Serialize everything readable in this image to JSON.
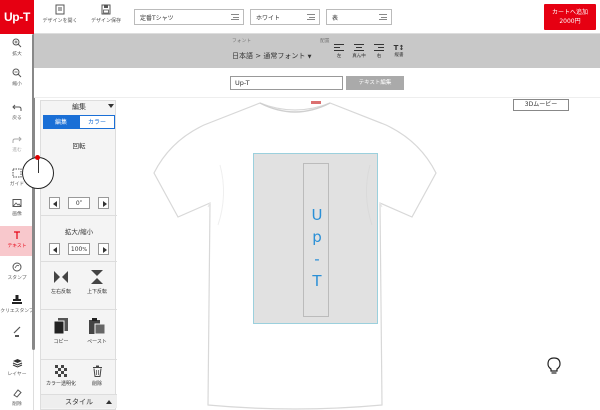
{
  "header": {
    "logo": "Up-T",
    "open_design": "デザインを開く",
    "save_design": "デザイン保存",
    "product_select": "定番Tシャツ",
    "color_select": "ホワイト",
    "side_select": "表",
    "cart_line1": "カートへ追加",
    "cart_line2": "2000円"
  },
  "sidebar": {
    "items": [
      {
        "label": "拡大"
      },
      {
        "label": "縮小"
      },
      {
        "label": "戻る"
      },
      {
        "label": "進む"
      },
      {
        "label": "ガイド"
      },
      {
        "label": "画像"
      },
      {
        "label": "テキスト"
      },
      {
        "label": "スタンプ"
      },
      {
        "label": "クリエスタンプ"
      },
      {
        "label": "ペン"
      },
      {
        "label": "レイヤー"
      },
      {
        "label": "削除"
      }
    ]
  },
  "toolbar": {
    "font_label": "フォント",
    "font_value": "日本語 > 通常フォント",
    "align_label": "配置",
    "align": [
      "左",
      "真ん中",
      "右",
      "縦書"
    ]
  },
  "text_input": {
    "value": "Up-T",
    "edit_button": "テキスト編集"
  },
  "panel": {
    "header": "編集",
    "tab_edit": "編集",
    "tab_color": "カラー",
    "rotation_label": "回転",
    "rotation_value": "0",
    "rotation_unit": "°",
    "scale_label": "拡大/縮小",
    "scale_value": "100",
    "scale_unit": "%",
    "flip_h": "左右反転",
    "flip_v": "上下反転",
    "copy": "コピー",
    "paste": "ペースト",
    "transparent": "カラー透明化",
    "delete": "削除",
    "style": "スタイル"
  },
  "canvas": {
    "button_3d": "3Dムービー",
    "design_text": [
      "U",
      "p",
      "-",
      "T"
    ]
  }
}
